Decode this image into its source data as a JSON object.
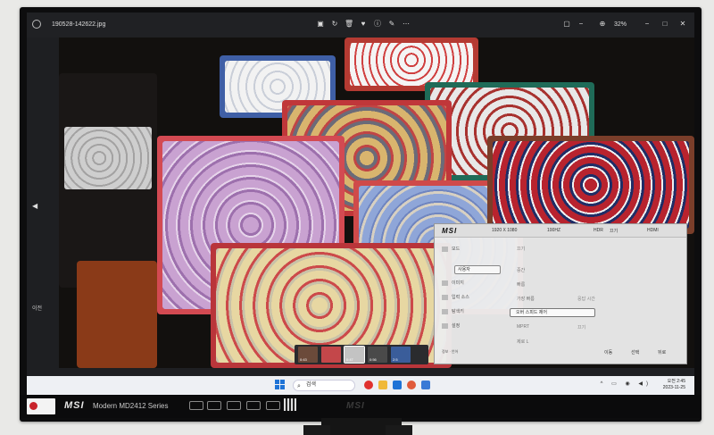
{
  "viewer": {
    "filename": "190528-142622.jpg",
    "zoom": "32%",
    "side_label": "이전"
  },
  "filmstrip": [
    {
      "label": "0:43"
    },
    {
      "label": ""
    },
    {
      "label": "0:47"
    },
    {
      "label": "0:56"
    },
    {
      "label": "2:5"
    }
  ],
  "taskbar": {
    "search_label": "검색",
    "clock_time": "오전 2:45",
    "clock_date": "2023-11-25"
  },
  "osd": {
    "logo": "MSI",
    "tabs": [
      "1920 X 1080",
      "100HZ",
      "HDR",
      "끄기",
      "HDMI"
    ],
    "left_items": [
      "모드",
      "사용자",
      "이미지",
      "입력 소스",
      "탐색키",
      "설정"
    ],
    "selected_left": "사용자",
    "mid_items": [
      "끄기",
      "중간",
      "빠름",
      "가장 빠름",
      "고급 움직임 제어",
      "MPRT",
      "HDCR",
      "제로 L"
    ],
    "selected_mid": "오버 스피드 제어",
    "right_items": [
      "응답 시간",
      "끄기"
    ],
    "footer": "정보 · 언어",
    "nav": [
      "이동",
      "선택",
      "뒤로"
    ]
  },
  "chin": {
    "brand": "MSI",
    "series": "Modern MD2412 Series",
    "center_logo": "MSI"
  },
  "colors": {
    "bezel": "#0d0d0e",
    "accent_red": "#c8232b",
    "win_blue": "#1f73d6"
  }
}
